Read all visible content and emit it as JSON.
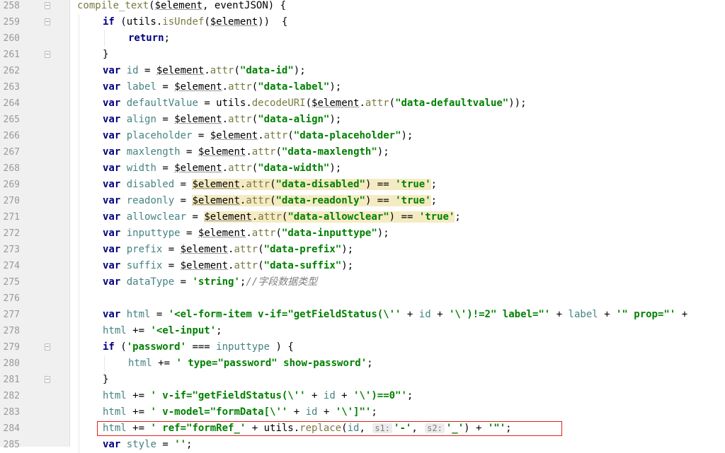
{
  "lines": [
    {
      "n": "258",
      "fold": true,
      "indent": 0,
      "segs": [
        [
          "fn",
          "compile_text"
        ],
        [
          "",
          "("
        ],
        [
          "var",
          "$element"
        ],
        [
          "",
          ", eventJSON) {"
        ]
      ]
    },
    {
      "n": "259",
      "fold": true,
      "indent": 1,
      "segs": [
        [
          "kw",
          "if"
        ],
        [
          "",
          " (utils."
        ],
        [
          "fn",
          "isUndef"
        ],
        [
          "",
          "("
        ],
        [
          "var",
          "$element"
        ],
        [
          "",
          "))  {"
        ]
      ]
    },
    {
      "n": "260",
      "fold": false,
      "indent": 2,
      "segs": [
        [
          "kw",
          "return"
        ],
        [
          "",
          ";"
        ]
      ]
    },
    {
      "n": "261",
      "fold": true,
      "indent": 1,
      "segs": [
        [
          "",
          "}"
        ]
      ]
    },
    {
      "n": "262",
      "fold": false,
      "indent": 1,
      "segs": [
        [
          "kw",
          "var"
        ],
        [
          "",
          " "
        ],
        [
          "loc",
          "id"
        ],
        [
          "",
          " = "
        ],
        [
          "var",
          "$element"
        ],
        [
          "",
          "."
        ],
        [
          "fn",
          "attr"
        ],
        [
          "",
          "("
        ],
        [
          "str",
          "\"data-id\""
        ],
        [
          "",
          ");"
        ]
      ]
    },
    {
      "n": "263",
      "fold": false,
      "indent": 1,
      "segs": [
        [
          "kw",
          "var"
        ],
        [
          "",
          " "
        ],
        [
          "loc",
          "label"
        ],
        [
          "",
          " = "
        ],
        [
          "var",
          "$element"
        ],
        [
          "",
          "."
        ],
        [
          "fn",
          "attr"
        ],
        [
          "",
          "("
        ],
        [
          "str",
          "\"data-label\""
        ],
        [
          "",
          ");"
        ]
      ]
    },
    {
      "n": "264",
      "fold": false,
      "indent": 1,
      "segs": [
        [
          "kw",
          "var"
        ],
        [
          "",
          " "
        ],
        [
          "loc",
          "defaultValue"
        ],
        [
          "",
          " = utils."
        ],
        [
          "fn",
          "decodeURI"
        ],
        [
          "",
          "("
        ],
        [
          "var",
          "$element"
        ],
        [
          "",
          "."
        ],
        [
          "fn",
          "attr"
        ],
        [
          "",
          "("
        ],
        [
          "str",
          "\"data-defaultvalue\""
        ],
        [
          "",
          "));"
        ]
      ]
    },
    {
      "n": "265",
      "fold": false,
      "indent": 1,
      "segs": [
        [
          "kw",
          "var"
        ],
        [
          "",
          " "
        ],
        [
          "loc",
          "align"
        ],
        [
          "",
          " = "
        ],
        [
          "var",
          "$element"
        ],
        [
          "",
          "."
        ],
        [
          "fn",
          "attr"
        ],
        [
          "",
          "("
        ],
        [
          "str",
          "\"data-align\""
        ],
        [
          "",
          ");"
        ]
      ]
    },
    {
      "n": "266",
      "fold": false,
      "indent": 1,
      "segs": [
        [
          "kw",
          "var"
        ],
        [
          "",
          " "
        ],
        [
          "loc",
          "placeholder"
        ],
        [
          "",
          " = "
        ],
        [
          "var",
          "$element"
        ],
        [
          "",
          "."
        ],
        [
          "fn",
          "attr"
        ],
        [
          "",
          "("
        ],
        [
          "str",
          "\"data-placeholder\""
        ],
        [
          "",
          ");"
        ]
      ]
    },
    {
      "n": "267",
      "fold": false,
      "indent": 1,
      "segs": [
        [
          "kw",
          "var"
        ],
        [
          "",
          " "
        ],
        [
          "loc",
          "maxlength"
        ],
        [
          "",
          " = "
        ],
        [
          "var",
          "$element"
        ],
        [
          "",
          "."
        ],
        [
          "fn",
          "attr"
        ],
        [
          "",
          "("
        ],
        [
          "str",
          "\"data-maxlength\""
        ],
        [
          "",
          ");"
        ]
      ]
    },
    {
      "n": "268",
      "fold": false,
      "indent": 1,
      "segs": [
        [
          "kw",
          "var"
        ],
        [
          "",
          " "
        ],
        [
          "loc",
          "width"
        ],
        [
          "",
          " = "
        ],
        [
          "var",
          "$element"
        ],
        [
          "",
          "."
        ],
        [
          "fn",
          "attr"
        ],
        [
          "",
          "("
        ],
        [
          "str",
          "\"data-width\""
        ],
        [
          "",
          ");"
        ]
      ]
    },
    {
      "n": "269",
      "fold": false,
      "indent": 1,
      "segs": [
        [
          "kw",
          "var"
        ],
        [
          "",
          " "
        ],
        [
          "loc",
          "disabled"
        ],
        [
          "",
          " = "
        ],
        [
          "hlvar",
          "$element"
        ],
        [
          "hl",
          "."
        ],
        [
          "hlfn",
          "attr"
        ],
        [
          "hl",
          "("
        ],
        [
          "hlstr",
          "\"data-disabled\""
        ],
        [
          "hl",
          ") == "
        ],
        [
          "hlstr",
          "'true'"
        ],
        [
          "",
          ";"
        ]
      ]
    },
    {
      "n": "270",
      "fold": false,
      "indent": 1,
      "segs": [
        [
          "kw",
          "var"
        ],
        [
          "",
          " "
        ],
        [
          "loc",
          "readonly"
        ],
        [
          "",
          " = "
        ],
        [
          "hlvar",
          "$element"
        ],
        [
          "hl",
          "."
        ],
        [
          "hlfn",
          "attr"
        ],
        [
          "hl",
          "("
        ],
        [
          "hlstr",
          "\"data-readonly\""
        ],
        [
          "hl",
          ") == "
        ],
        [
          "hlstr",
          "'true'"
        ],
        [
          "",
          ";"
        ]
      ]
    },
    {
      "n": "271",
      "fold": false,
      "indent": 1,
      "segs": [
        [
          "kw",
          "var"
        ],
        [
          "",
          " "
        ],
        [
          "loc",
          "allowclear"
        ],
        [
          "",
          " = "
        ],
        [
          "hlvar",
          "$element"
        ],
        [
          "hl",
          "."
        ],
        [
          "hlfn",
          "attr"
        ],
        [
          "hl",
          "("
        ],
        [
          "hlstr",
          "\"data-allowclear\""
        ],
        [
          "hl",
          ") == "
        ],
        [
          "hlstr",
          "'true'"
        ],
        [
          "",
          ";"
        ]
      ]
    },
    {
      "n": "272",
      "fold": false,
      "indent": 1,
      "segs": [
        [
          "kw",
          "var"
        ],
        [
          "",
          " "
        ],
        [
          "loc",
          "inputtype"
        ],
        [
          "",
          " = "
        ],
        [
          "var",
          "$element"
        ],
        [
          "",
          "."
        ],
        [
          "fn",
          "attr"
        ],
        [
          "",
          "("
        ],
        [
          "str",
          "\"data-inputtype\""
        ],
        [
          "",
          ");"
        ]
      ]
    },
    {
      "n": "273",
      "fold": false,
      "indent": 1,
      "segs": [
        [
          "kw",
          "var"
        ],
        [
          "",
          " "
        ],
        [
          "loc",
          "prefix"
        ],
        [
          "",
          " = "
        ],
        [
          "var",
          "$element"
        ],
        [
          "",
          "."
        ],
        [
          "fn",
          "attr"
        ],
        [
          "",
          "("
        ],
        [
          "str",
          "\"data-prefix\""
        ],
        [
          "",
          ");"
        ]
      ]
    },
    {
      "n": "274",
      "fold": false,
      "indent": 1,
      "segs": [
        [
          "kw",
          "var"
        ],
        [
          "",
          " "
        ],
        [
          "loc",
          "suffix"
        ],
        [
          "",
          " = "
        ],
        [
          "var",
          "$element"
        ],
        [
          "",
          "."
        ],
        [
          "fn",
          "attr"
        ],
        [
          "",
          "("
        ],
        [
          "str",
          "\"data-suffix\""
        ],
        [
          "",
          ");"
        ]
      ]
    },
    {
      "n": "275",
      "fold": false,
      "indent": 1,
      "segs": [
        [
          "kw",
          "var"
        ],
        [
          "",
          " "
        ],
        [
          "loc",
          "dataType"
        ],
        [
          "",
          " = "
        ],
        [
          "str",
          "'string'"
        ],
        [
          "",
          ";"
        ],
        [
          "cmt",
          "//字段数据类型"
        ]
      ]
    },
    {
      "n": "276",
      "fold": false,
      "indent": 1,
      "segs": []
    },
    {
      "n": "277",
      "fold": false,
      "indent": 1,
      "segs": [
        [
          "kw",
          "var"
        ],
        [
          "",
          " "
        ],
        [
          "loc",
          "html"
        ],
        [
          "",
          " = "
        ],
        [
          "str",
          "'<el-form-item v-if=\"getFieldStatus(\\''"
        ],
        [
          "",
          " + "
        ],
        [
          "loc",
          "id"
        ],
        [
          "",
          " + "
        ],
        [
          "str",
          "'\\')!=2\" label=\"'"
        ],
        [
          "",
          " + "
        ],
        [
          "loc",
          "label"
        ],
        [
          "",
          " + "
        ],
        [
          "str",
          "'\" prop=\"'"
        ],
        [
          "",
          " +"
        ]
      ]
    },
    {
      "n": "278",
      "fold": false,
      "indent": 1,
      "segs": [
        [
          "loc",
          "html"
        ],
        [
          "",
          " += "
        ],
        [
          "str",
          "'<el-input'"
        ],
        [
          "",
          ";"
        ]
      ]
    },
    {
      "n": "279",
      "fold": true,
      "indent": 1,
      "segs": [
        [
          "kw",
          "if"
        ],
        [
          "",
          " ("
        ],
        [
          "str",
          "'password'"
        ],
        [
          "",
          " === "
        ],
        [
          "loc",
          "inputtype"
        ],
        [
          "",
          " ) {"
        ]
      ]
    },
    {
      "n": "280",
      "fold": false,
      "indent": 2,
      "segs": [
        [
          "loc",
          "html"
        ],
        [
          "",
          " += "
        ],
        [
          "str",
          "' type=\"password\" show-password'"
        ],
        [
          "",
          ";"
        ]
      ]
    },
    {
      "n": "281",
      "fold": true,
      "indent": 1,
      "segs": [
        [
          "",
          "}"
        ]
      ]
    },
    {
      "n": "282",
      "fold": false,
      "indent": 1,
      "segs": [
        [
          "loc",
          "html"
        ],
        [
          "",
          " += "
        ],
        [
          "str",
          "' v-if=\"getFieldStatus(\\''"
        ],
        [
          "",
          " + "
        ],
        [
          "loc",
          "id"
        ],
        [
          "",
          " + "
        ],
        [
          "str",
          "'\\')==0\"'"
        ],
        [
          "",
          ";"
        ]
      ]
    },
    {
      "n": "283",
      "fold": false,
      "indent": 1,
      "segs": [
        [
          "loc",
          "html"
        ],
        [
          "",
          " += "
        ],
        [
          "str",
          "' v-model=\"formData[\\''"
        ],
        [
          "",
          " + "
        ],
        [
          "loc",
          "id"
        ],
        [
          "",
          " + "
        ],
        [
          "str",
          "'\\']\"'"
        ],
        [
          "",
          ";"
        ]
      ]
    },
    {
      "n": "284",
      "fold": false,
      "indent": 1,
      "segs": [
        [
          "loc",
          "html"
        ],
        [
          "",
          " += "
        ],
        [
          "str",
          "' ref=\"formRef_'"
        ],
        [
          "",
          " + utils."
        ],
        [
          "fn",
          "replace"
        ],
        [
          "",
          "("
        ],
        [
          "loc",
          "id"
        ],
        [
          "",
          ", "
        ],
        [
          "hint",
          "s1:"
        ],
        [
          "str",
          "'-'"
        ],
        [
          "",
          ", "
        ],
        [
          "hint",
          "s2:"
        ],
        [
          "str",
          "'_'"
        ],
        [
          "",
          ") + "
        ],
        [
          "str",
          "'\"'"
        ],
        [
          "",
          ";"
        ]
      ]
    },
    {
      "n": "285",
      "fold": false,
      "indent": 1,
      "segs": [
        [
          "kw",
          "var"
        ],
        [
          "",
          " "
        ],
        [
          "loc",
          "style"
        ],
        [
          "",
          " = "
        ],
        [
          "str",
          "''"
        ],
        [
          "",
          ";"
        ]
      ]
    }
  ]
}
